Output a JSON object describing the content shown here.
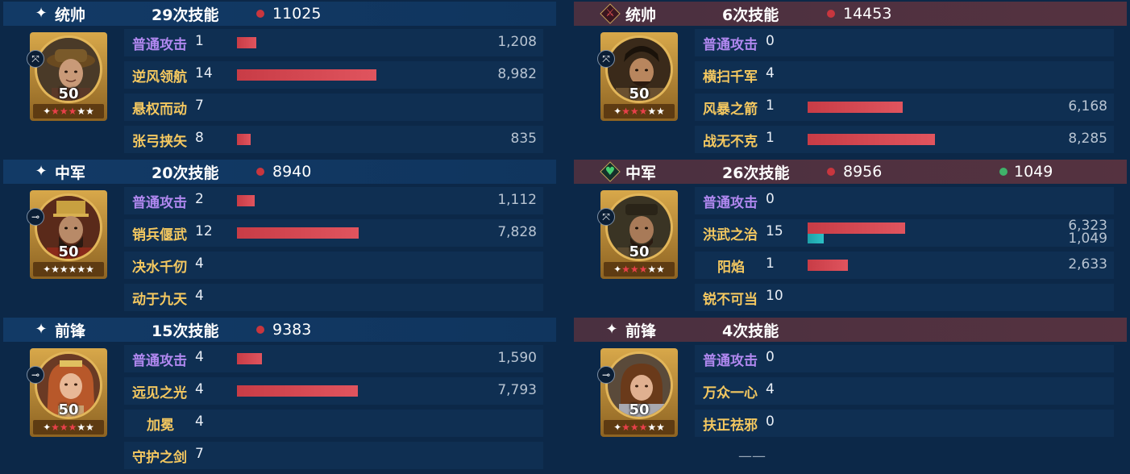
{
  "left": {
    "blocks": [
      {
        "role": "统帅",
        "count": "29次技能",
        "damage": "11025",
        "level": "50",
        "stars": [
          "w",
          "r",
          "r",
          "r",
          "w",
          "w"
        ],
        "skills": [
          {
            "name": "普通攻击",
            "count": "1",
            "value": "1,208",
            "bar": 0.102
          },
          {
            "name": "逆风领航",
            "count": "14",
            "value": "8,982",
            "bar": 0.752
          },
          {
            "name": "悬权而动",
            "count": "7",
            "value": "",
            "bar": 0
          },
          {
            "name": "张弓挟矢",
            "count": "8",
            "value": "835",
            "bar": 0.07
          }
        ]
      },
      {
        "role": "中军",
        "count": "20次技能",
        "damage": "8940",
        "level": "50",
        "stars": [
          "w",
          "w",
          "w",
          "w",
          "w",
          "w"
        ],
        "skills": [
          {
            "name": "普通攻击",
            "count": "2",
            "value": "1,112",
            "bar": 0.093
          },
          {
            "name": "销兵偃武",
            "count": "12",
            "value": "7,828",
            "bar": 0.656
          },
          {
            "name": "决水千仞",
            "count": "4",
            "value": "",
            "bar": 0
          },
          {
            "name": "动于九天",
            "count": "4",
            "value": "",
            "bar": 0
          }
        ]
      },
      {
        "role": "前锋",
        "count": "15次技能",
        "damage": "9383",
        "level": "50",
        "stars": [
          "w",
          "r",
          "r",
          "r",
          "w",
          "w"
        ],
        "skills": [
          {
            "name": "普通攻击",
            "count": "4",
            "value": "1,590",
            "bar": 0.133
          },
          {
            "name": "远见之光",
            "count": "4",
            "value": "7,793",
            "bar": 0.652
          },
          {
            "name": "加冕",
            "count": "4",
            "value": "",
            "bar": 0
          },
          {
            "name": "守护之剑",
            "count": "7",
            "value": "",
            "bar": 0
          }
        ]
      }
    ]
  },
  "right": {
    "blocks": [
      {
        "role": "统帅",
        "count": "6次技能",
        "damage": "14453",
        "level": "50",
        "stars": [
          "w",
          "r",
          "r",
          "r",
          "w",
          "w"
        ],
        "skills": [
          {
            "name": "普通攻击",
            "count": "0",
            "value": "",
            "bar": 0
          },
          {
            "name": "横扫千军",
            "count": "4",
            "value": "",
            "bar": 0
          },
          {
            "name": "风暴之箭",
            "count": "1",
            "value": "6,168",
            "bar": 0.516
          },
          {
            "name": "战无不克",
            "count": "1",
            "value": "8,285",
            "bar": 0.694
          }
        ]
      },
      {
        "role": "中军",
        "count": "26次技能",
        "damage": "8956",
        "heal": "1049",
        "level": "50",
        "stars": [
          "w",
          "r",
          "r",
          "r",
          "w",
          "w"
        ],
        "skills": [
          {
            "name": "普通攻击",
            "count": "0",
            "value": "",
            "bar": 0
          },
          {
            "name": "洪武之治",
            "count": "15",
            "value": "6,323",
            "value2": "1,049",
            "bar": 0.529,
            "bar2": 0.088
          },
          {
            "name": "阳焰",
            "count": "1",
            "value": "2,633",
            "bar": 0.22
          },
          {
            "name": "锐不可当",
            "count": "10",
            "value": "",
            "bar": 0
          }
        ]
      },
      {
        "role": "前锋",
        "count": "4次技能",
        "level": "50",
        "stars": [
          "w",
          "r",
          "r",
          "r",
          "w",
          "w"
        ],
        "skills": [
          {
            "name": "普通攻击",
            "count": "0",
            "value": "",
            "bar": 0
          },
          {
            "name": "万众一心",
            "count": "4",
            "value": "",
            "bar": 0
          },
          {
            "name": "扶正祛邪",
            "count": "0",
            "value": "",
            "bar": 0
          }
        ],
        "footer": "——"
      }
    ]
  },
  "colors": {
    "damage_bar": "#c83c46",
    "heal_bar": "#1ea0a8",
    "basic_skill": "#b188f0",
    "skill_name": "#f4c860"
  },
  "icons": {
    "left_role_icons": [
      "sparkle-icon",
      "sparkle-icon",
      "sparkle-icon"
    ],
    "right_role_icons": [
      "red-sword-diamond-icon",
      "green-heart-diamond-icon",
      "sparkle-icon"
    ],
    "weapon_icons": [
      "bow-icon",
      "cannon-icon",
      "cannon-icon",
      "cannon-icon",
      "bow-icon",
      "cannon-icon"
    ]
  }
}
